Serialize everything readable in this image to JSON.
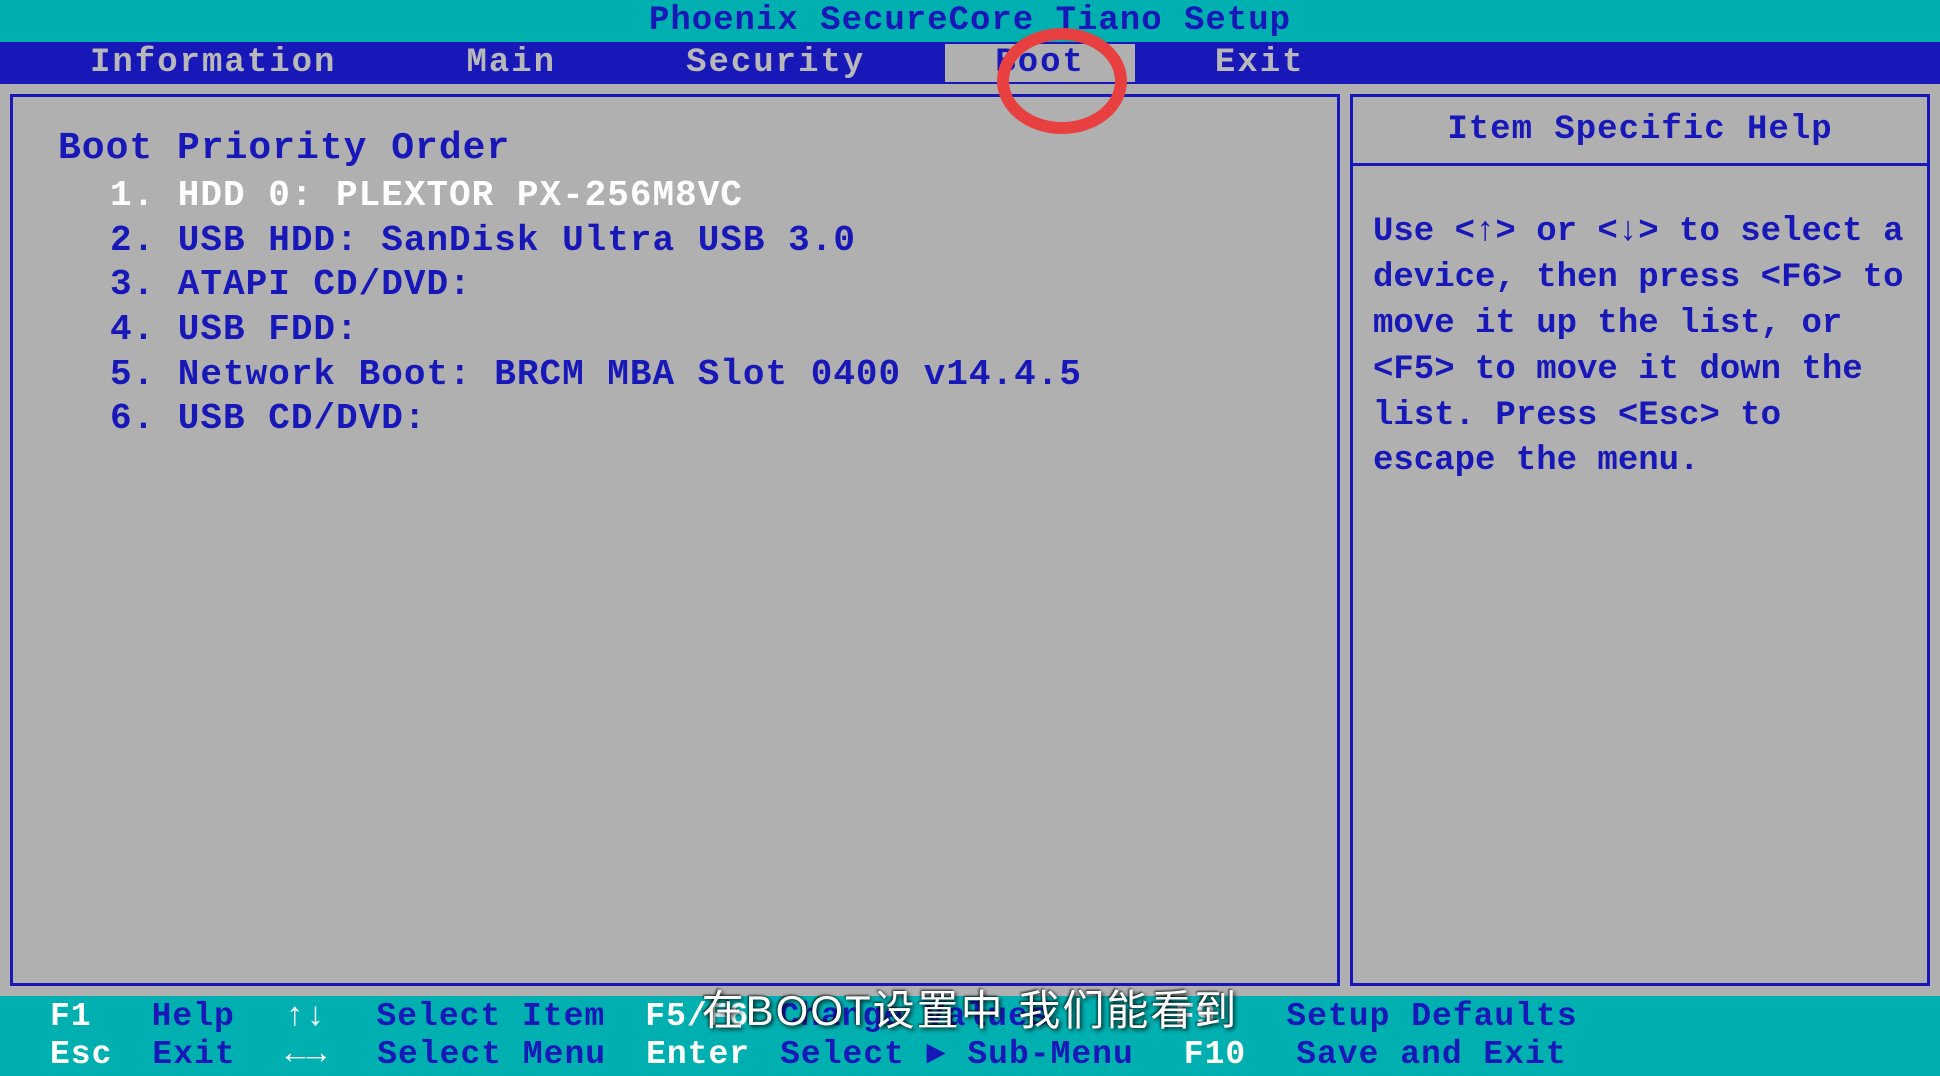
{
  "title": "Phoenix SecureCore Tiano Setup",
  "menu": {
    "items": [
      "Information",
      "Main",
      "Security",
      "Boot",
      "Exit"
    ],
    "active_index": 3
  },
  "main": {
    "header": "Boot Priority Order",
    "boot_items": [
      "1. HDD 0: PLEXTOR PX-256M8VC",
      "2. USB HDD: SanDisk Ultra USB 3.0",
      "3. ATAPI CD/DVD:",
      "4. USB FDD:",
      "5. Network Boot: BRCM MBA Slot 0400 v14.4.5",
      "6. USB CD/DVD:"
    ],
    "selected_index": 0
  },
  "help": {
    "title": "Item Specific Help",
    "text": "Use <↑> or <↓> to select a device, then press <F6> to move it up the list, or <F5> to move it down the list. Press <Esc> to escape the menu."
  },
  "footer": {
    "row1": [
      {
        "key": "F1",
        "label": "Help"
      },
      {
        "key": "↑↓",
        "label": "Select Item"
      },
      {
        "key": "F5/F6",
        "label": "Change Values"
      },
      {
        "key": "F9",
        "label": "Setup Defaults"
      }
    ],
    "row2": [
      {
        "key": "Esc",
        "label": "Exit"
      },
      {
        "key": "←→",
        "label": "Select Menu"
      },
      {
        "key": "Enter",
        "label": "Select ► Sub-Menu"
      },
      {
        "key": "F10",
        "label": "Save and Exit"
      }
    ]
  },
  "subtitle": "在BOOT设置中 我们能看到",
  "colors": {
    "teal": "#00b0b0",
    "blue": "#1818b8",
    "gray": "#b0b0b0",
    "white": "#ffffff",
    "red": "#e84040"
  }
}
